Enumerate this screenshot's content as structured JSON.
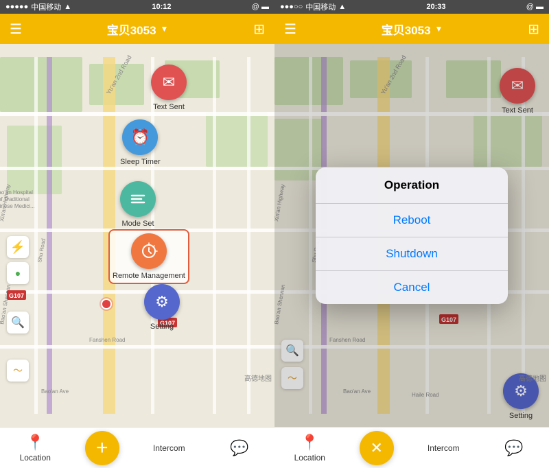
{
  "left_panel": {
    "status_bar": {
      "dots": "●●●●●",
      "carrier": "中国移动",
      "wifi": "WiFi",
      "time": "10:12",
      "charge": "@ ▬▬"
    },
    "nav": {
      "title": "宝贝3053",
      "dropdown": "▼",
      "grid_icon": "⊞"
    },
    "menu_items": [
      {
        "id": "text-sent",
        "label": "Text Sent",
        "color": "#e05252",
        "icon": "✉"
      },
      {
        "id": "sleep-timer",
        "label": "Sleep Timer",
        "color": "#4499dd",
        "icon": "⏰"
      },
      {
        "id": "mode-set",
        "label": "Mode Set",
        "color": "#4db8a0",
        "icon": "≋"
      },
      {
        "id": "remote-management",
        "label": "Remote Management",
        "color": "#f07840",
        "icon": "⟳",
        "highlighted": true
      },
      {
        "id": "setting",
        "label": "Setting",
        "color": "#5566cc",
        "icon": "⚙"
      }
    ],
    "tab_bar": {
      "location": "Location",
      "add": "+",
      "intercom": "Intercom",
      "chat_icon": "💬"
    },
    "road_badges": [
      "G107"
    ],
    "map_attribution": "高德地图"
  },
  "right_panel": {
    "status_bar": {
      "dots": "●●●○○",
      "carrier": "中国移动",
      "wifi": "WiFi",
      "time": "20:33",
      "charge": "@ ▬▬"
    },
    "nav": {
      "title": "宝贝3053",
      "dropdown": "▼",
      "grid_icon": "⊞"
    },
    "dialog": {
      "title": "Operation",
      "buttons": [
        "Reboot",
        "Shutdown",
        "Cancel"
      ]
    },
    "tab_bar": {
      "location": "Location",
      "cancel_icon": "✕",
      "intercom": "Intercom",
      "chat_icon": "💬"
    },
    "map_attribution": "高德地图"
  }
}
